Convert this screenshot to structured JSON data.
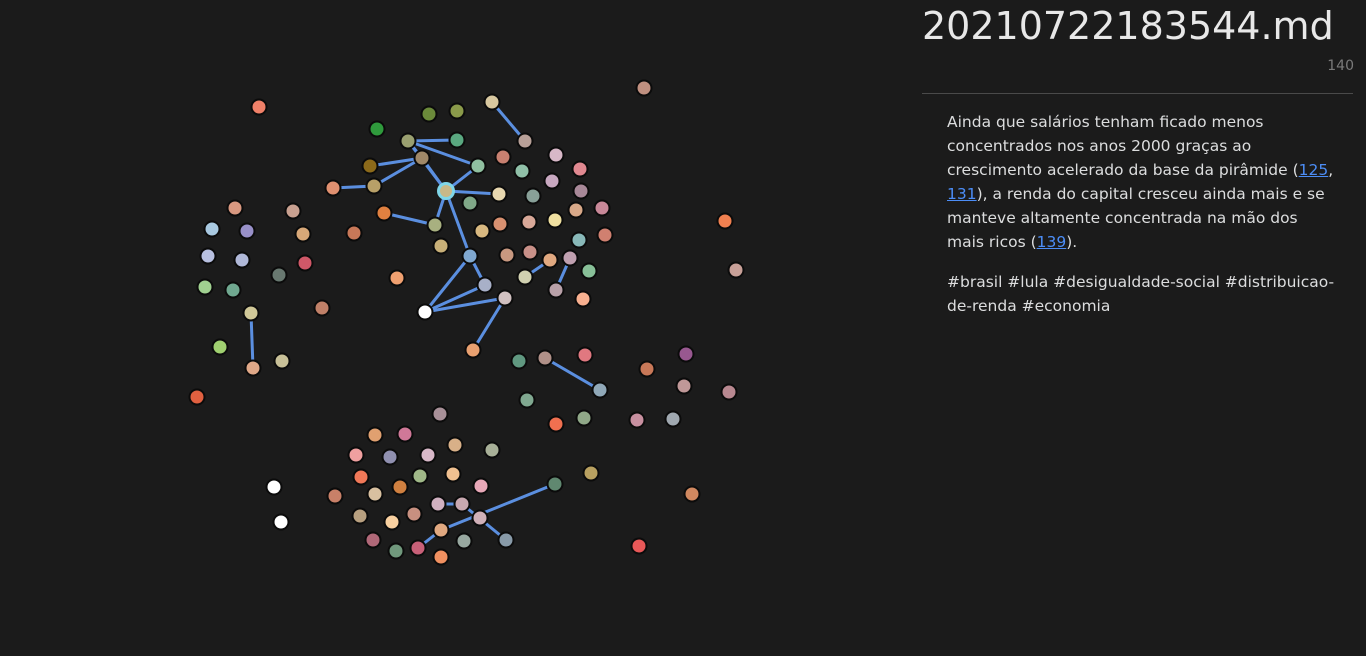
{
  "note": {
    "title": "20210722183544.md",
    "count": "140",
    "para_before": "Ainda que salários tenham ficado menos concentrados nos anos 2000 graças ao crescimento acelerado da base da pirâmide (",
    "link1": "125",
    "sep1": ", ",
    "link2": "131",
    "para_middle": "), a renda do capital cresceu ainda mais e se manteve altamente concentrada na mão dos mais ricos (",
    "link3": "139",
    "para_after": ").",
    "tags": "#brasil #lula #desigualdade-social #distribuicao-de-renda #economia"
  },
  "colors": {
    "background": "#1b1b1b",
    "edge": "#5b8fe0",
    "link": "#4c8df6",
    "active_node_ring": "#7fd6e8"
  }
}
